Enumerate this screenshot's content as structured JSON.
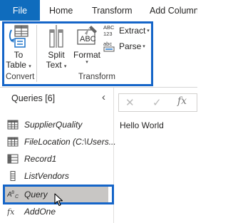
{
  "tabs": {
    "file": "File",
    "home": "Home",
    "transform": "Transform",
    "add_column": "Add Column"
  },
  "ribbon": {
    "to_table": {
      "line1": "To",
      "line2": "Table",
      "icon": "table-convert-icon"
    },
    "split_text": {
      "line1": "Split",
      "line2": "Text",
      "icon": "split-column-icon"
    },
    "format": {
      "label": "Format",
      "icon": "text-format-icon"
    },
    "extract": {
      "label": "Extract",
      "icon": "extract-text-icon"
    },
    "parse": {
      "label": "Parse",
      "icon": "parse-text-icon"
    },
    "groups": {
      "convert": "Convert",
      "transform": "Transform"
    }
  },
  "queries": {
    "title": "Queries [6]",
    "items": [
      {
        "label": "SupplierQuality",
        "icon": "table-icon",
        "selected": false
      },
      {
        "label": "FileLocation (C:\\Users...",
        "icon": "table-icon",
        "selected": false
      },
      {
        "label": "Record1",
        "icon": "record-icon",
        "selected": false
      },
      {
        "label": "ListVendors",
        "icon": "list-icon",
        "selected": false
      },
      {
        "label": "Query",
        "icon": "text-type-icon",
        "selected": true
      },
      {
        "label": "AddOne",
        "icon": "function-icon",
        "selected": false
      }
    ]
  },
  "formula_bar": {
    "fx": "fx"
  },
  "result": {
    "value": "Hello World"
  },
  "colors": {
    "accent": "#0f6cbd",
    "highlight": "#1565c8",
    "selected": "#c8c6c4"
  }
}
